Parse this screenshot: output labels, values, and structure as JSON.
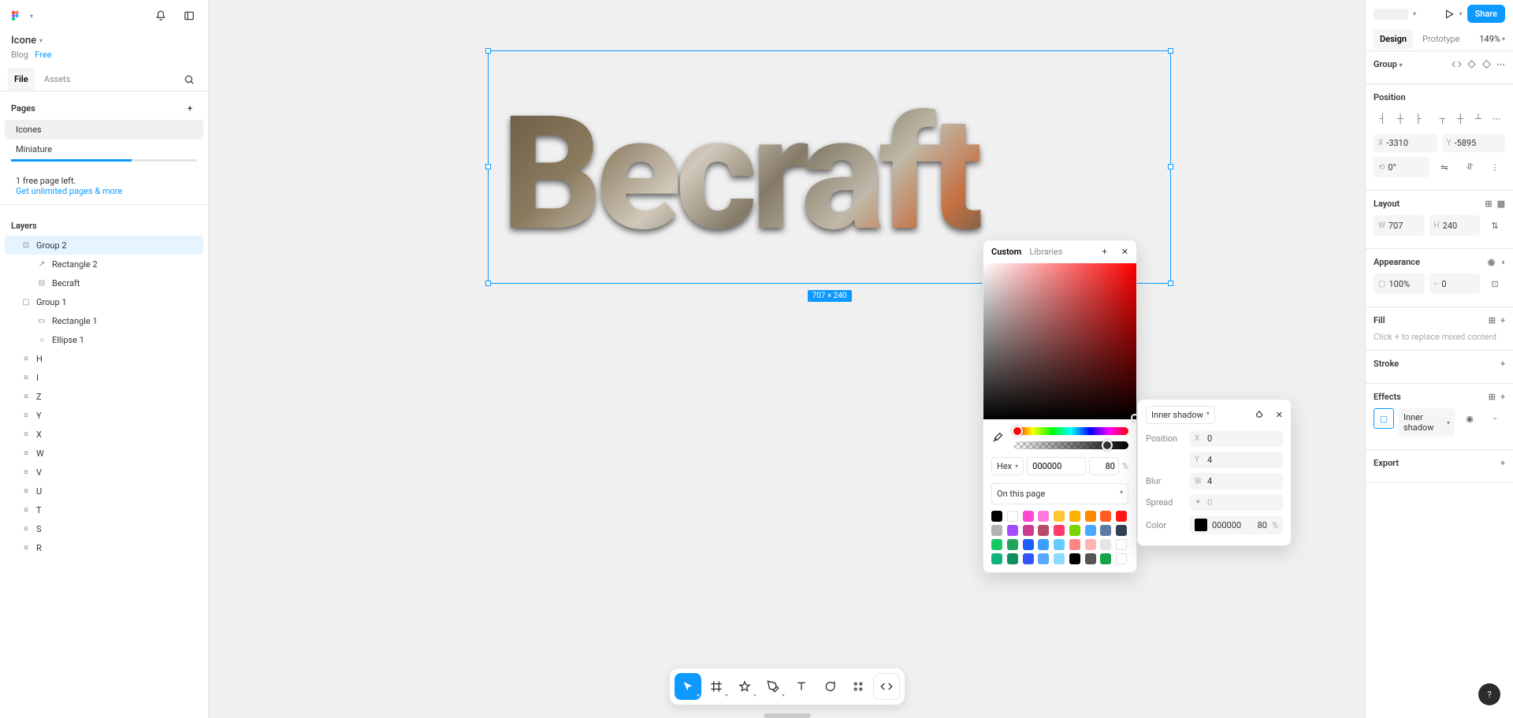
{
  "file": {
    "title": "Icone",
    "breadcrumb_team": "Blog",
    "breadcrumb_plan": "Free"
  },
  "left_tabs": {
    "file": "File",
    "assets": "Assets"
  },
  "pages": {
    "head": "Pages",
    "list": [
      "Icones",
      "Miniature"
    ]
  },
  "free": {
    "line1": "1 free page left.",
    "line2": "Get unlimited pages & more"
  },
  "layers": {
    "head": "Layers",
    "tree": [
      {
        "name": "Group 2",
        "sel": true,
        "ic": "group",
        "ind": 0
      },
      {
        "name": "Rectangle 2",
        "ic": "arrow",
        "ind": 2
      },
      {
        "name": "Becraft",
        "ic": "text",
        "ind": 2
      },
      {
        "name": "Group 1",
        "ic": "frame",
        "ind": 0
      },
      {
        "name": "Rectangle 1",
        "ic": "rect",
        "ind": 2
      },
      {
        "name": "Ellipse 1",
        "ic": "circ",
        "ind": 2
      },
      {
        "name": "H",
        "ic": "txt",
        "ind": 0
      },
      {
        "name": "I",
        "ic": "txt",
        "ind": 0
      },
      {
        "name": "Z",
        "ic": "txt",
        "ind": 0
      },
      {
        "name": "Y",
        "ic": "txt",
        "ind": 0
      },
      {
        "name": "X",
        "ic": "txt",
        "ind": 0
      },
      {
        "name": "W",
        "ic": "txt",
        "ind": 0
      },
      {
        "name": "V",
        "ic": "txt",
        "ind": 0
      },
      {
        "name": "U",
        "ic": "txt",
        "ind": 0
      },
      {
        "name": "T",
        "ic": "txt",
        "ind": 0
      },
      {
        "name": "S",
        "ic": "txt",
        "ind": 0
      },
      {
        "name": "R",
        "ic": "txt",
        "ind": 0
      }
    ]
  },
  "canvas": {
    "text": "Becraft",
    "dim": "707 × 240"
  },
  "picker": {
    "custom": "Custom",
    "libraries": "Libraries",
    "hexMode": "Hex",
    "hex": "000000",
    "alpha": "80",
    "pct": "%",
    "onpage": "On this page",
    "swatches": [
      "#000000",
      "#ffffff",
      "#ff49d1",
      "#ff7bde",
      "#ffc832",
      "#ffb000",
      "#ff8a00",
      "#ff5a1f",
      "#ff1616",
      "#b3b3b3",
      "#a24bff",
      "#cc3d8f",
      "#b84a6a",
      "#ff3b6b",
      "#78d400",
      "#4aa8ff",
      "#5b7ca0",
      "#334155",
      "#17c964",
      "#22a55e",
      "#1c5fff",
      "#3aa0ff",
      "#66ccff",
      "#ff8585",
      "#ffb4b4",
      "#e5e5e5",
      "#ffffff",
      "#0fb57a",
      "#0f8f62",
      "#3355ff",
      "#55aaff",
      "#88ddff",
      "#000000",
      "#555555",
      "#16a34a",
      "#ffffff"
    ]
  },
  "fx": {
    "type": "Inner shadow",
    "pos": "Position",
    "x": "0",
    "y": "4",
    "blur": "Blur",
    "blurV": "4",
    "spread": "Spread",
    "spreadV": "0",
    "color": "Color",
    "hex": "000000",
    "alpha": "80",
    "pct": "%"
  },
  "right": {
    "share": "Share",
    "designTab": "Design",
    "protoTab": "Prototype",
    "zoom": "149%",
    "groupHead": "Group",
    "position": "Position",
    "x": "-3310",
    "y": "-5895",
    "rot": "0°",
    "layout": "Layout",
    "w": "707",
    "h": "240",
    "appearance": "Appearance",
    "op": "100%",
    "radius": "0",
    "fill": "Fill",
    "fillPlaceholder": "Click + to replace mixed content",
    "stroke": "Stroke",
    "effects": "Effects",
    "effectType": "Inner shadow",
    "export": "Export"
  }
}
